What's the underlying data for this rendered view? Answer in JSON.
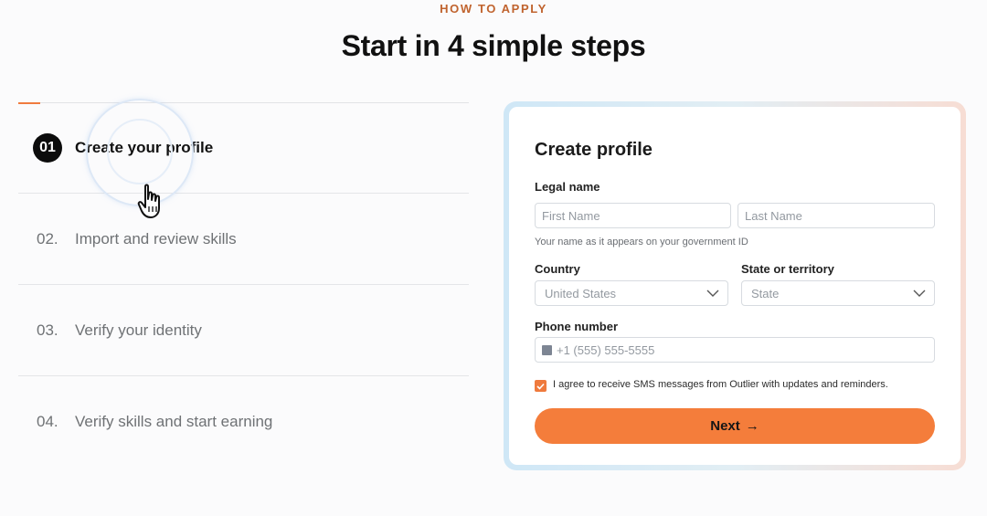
{
  "header": {
    "eyebrow": "HOW TO APPLY",
    "title": "Start in 4 simple steps"
  },
  "steps": [
    {
      "number": "01",
      "label": "Create your profile",
      "active": true
    },
    {
      "number": "02.",
      "label": "Import and review skills",
      "active": false
    },
    {
      "number": "03.",
      "label": "Verify your identity",
      "active": false
    },
    {
      "number": "04.",
      "label": "Verify skills and start earning",
      "active": false
    }
  ],
  "form": {
    "title": "Create profile",
    "legal_name_label": "Legal name",
    "first_name_placeholder": "First Name",
    "last_name_placeholder": "Last Name",
    "name_hint": "Your name as it appears on your government ID",
    "country_label": "Country",
    "country_value": "United States",
    "state_label": "State or territory",
    "state_value": "State",
    "phone_label": "Phone number",
    "phone_placeholder": "+1 (555) 555-5555",
    "sms_consent": "I agree to receive SMS messages from Outlier with updates and reminders.",
    "sms_checked": true,
    "next_label": "Next",
    "next_arrow": "→"
  },
  "colors": {
    "accent": "#f47d3b",
    "eyebrow": "#c0632e"
  },
  "icons": {
    "cursor": "hand-pointer-icon",
    "dropdown": "chevron-down-icon",
    "phone_flag": "flag-icon",
    "checkbox": "check-icon"
  }
}
